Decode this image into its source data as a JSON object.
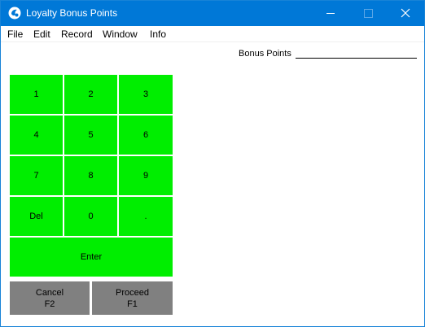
{
  "window": {
    "title": "Loyalty Bonus Points",
    "title_bar_color": "#0078d7",
    "controls": {
      "minimize_icon": "minimize-icon",
      "maximize_icon": "maximize-icon",
      "close_icon": "close-icon"
    }
  },
  "menu": [
    "File",
    "Edit",
    "Record",
    "Window",
    "Info"
  ],
  "form": {
    "bonus_points_label": "Bonus Points",
    "bonus_points_value": ""
  },
  "keypad": {
    "key_color": "#00ee00",
    "keys": [
      "1",
      "2",
      "3",
      "4",
      "5",
      "6",
      "7",
      "8",
      "9",
      "Del",
      "0",
      "."
    ],
    "enter_label": "Enter"
  },
  "actions": {
    "button_color": "#808080",
    "cancel": {
      "label": "Cancel",
      "shortcut": "F2"
    },
    "proceed": {
      "label": "Proceed",
      "shortcut": "F1"
    }
  }
}
